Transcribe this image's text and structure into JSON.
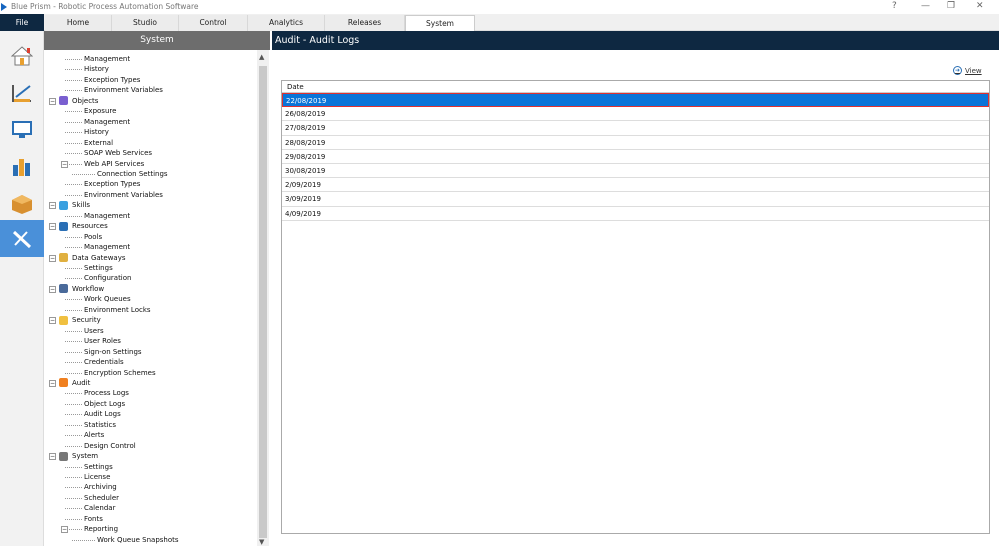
{
  "window": {
    "title": "Blue Prism - Robotic Process Automation Software",
    "help": "?",
    "minimize": "—",
    "restore": "❐",
    "close": "✕"
  },
  "menu": {
    "file": "File",
    "tabs": [
      "Home",
      "Studio",
      "Control",
      "Analytics",
      "Releases",
      "System"
    ],
    "selected_tab": "System"
  },
  "sidebar": {
    "items": [
      {
        "name": "home"
      },
      {
        "name": "studio"
      },
      {
        "name": "control"
      },
      {
        "name": "analytics"
      },
      {
        "name": "releases"
      },
      {
        "name": "system",
        "selected": true
      }
    ]
  },
  "tree": {
    "title": "System",
    "items": [
      {
        "label": "Management",
        "level": 1
      },
      {
        "label": "History",
        "level": 1
      },
      {
        "label": "Exception Types",
        "level": 1
      },
      {
        "label": "Environment Variables",
        "level": 1
      },
      {
        "label": "Objects",
        "level": 0,
        "icon": "#7a5fd0"
      },
      {
        "label": "Exposure",
        "level": 1
      },
      {
        "label": "Management",
        "level": 1
      },
      {
        "label": "History",
        "level": 1
      },
      {
        "label": "External",
        "level": 1
      },
      {
        "label": "SOAP Web Services",
        "level": 1
      },
      {
        "label": "Web API Services",
        "level": 1,
        "expandable": true
      },
      {
        "label": "Connection Settings",
        "level": 2
      },
      {
        "label": "Exception Types",
        "level": 1
      },
      {
        "label": "Environment Variables",
        "level": 1
      },
      {
        "label": "Skills",
        "level": 0,
        "icon": "#3aa0e0"
      },
      {
        "label": "Management",
        "level": 1
      },
      {
        "label": "Resources",
        "level": 0,
        "icon": "#2a6fb5"
      },
      {
        "label": "Pools",
        "level": 1
      },
      {
        "label": "Management",
        "level": 1
      },
      {
        "label": "Data Gateways",
        "level": 0,
        "icon": "#e0b040"
      },
      {
        "label": "Settings",
        "level": 1
      },
      {
        "label": "Configuration",
        "level": 1
      },
      {
        "label": "Workflow",
        "level": 0,
        "icon": "#4a6a9a"
      },
      {
        "label": "Work Queues",
        "level": 1
      },
      {
        "label": "Environment Locks",
        "level": 1
      },
      {
        "label": "Security",
        "level": 0,
        "icon": "#f0c040"
      },
      {
        "label": "Users",
        "level": 1
      },
      {
        "label": "User Roles",
        "level": 1
      },
      {
        "label": "Sign-on Settings",
        "level": 1
      },
      {
        "label": "Credentials",
        "level": 1
      },
      {
        "label": "Encryption Schemes",
        "level": 1
      },
      {
        "label": "Audit",
        "level": 0,
        "icon": "#f08020"
      },
      {
        "label": "Process Logs",
        "level": 1
      },
      {
        "label": "Object Logs",
        "level": 1
      },
      {
        "label": "Audit Logs",
        "level": 1
      },
      {
        "label": "Statistics",
        "level": 1
      },
      {
        "label": "Alerts",
        "level": 1
      },
      {
        "label": "Design Control",
        "level": 1
      },
      {
        "label": "System",
        "level": 0,
        "icon": "#777777"
      },
      {
        "label": "Settings",
        "level": 1
      },
      {
        "label": "License",
        "level": 1
      },
      {
        "label": "Archiving",
        "level": 1
      },
      {
        "label": "Scheduler",
        "level": 1
      },
      {
        "label": "Calendar",
        "level": 1
      },
      {
        "label": "Fonts",
        "level": 1
      },
      {
        "label": "Reporting",
        "level": 1,
        "expandable": true
      },
      {
        "label": "Work Queue Snapshots",
        "level": 2
      }
    ]
  },
  "main": {
    "title": "Audit - Audit Logs",
    "view_link": "View",
    "column": "Date",
    "rows": [
      "22/08/2019",
      "26/08/2019",
      "27/08/2019",
      "28/08/2019",
      "29/08/2019",
      "30/08/2019",
      "2/09/2019",
      "3/09/2019",
      "4/09/2019"
    ],
    "selected_row": 0
  }
}
